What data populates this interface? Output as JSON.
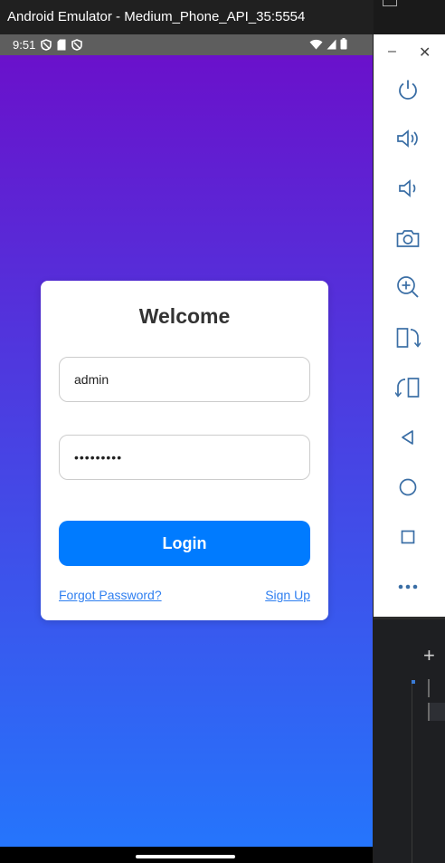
{
  "window": {
    "title": "Android Emulator - Medium_Phone_API_35:5554"
  },
  "statusbar": {
    "time": "9:51"
  },
  "login": {
    "title": "Welcome",
    "username_value": "admin",
    "password_mask": "•••••••••",
    "login_label": "Login",
    "forgot_label": "Forgot Password?",
    "signup_label": "Sign Up"
  },
  "colors": {
    "gradient_top": "#6a11cb",
    "gradient_bottom": "#2575fc",
    "button": "#007bff",
    "link": "#2f7ff0"
  },
  "toolbar": {
    "icons": [
      "power-icon",
      "volume-up-icon",
      "volume-down-icon",
      "camera-icon",
      "zoom-in-icon",
      "rotate-left-icon",
      "rotate-right-icon",
      "back-icon",
      "home-icon",
      "overview-icon",
      "more-icon"
    ]
  }
}
